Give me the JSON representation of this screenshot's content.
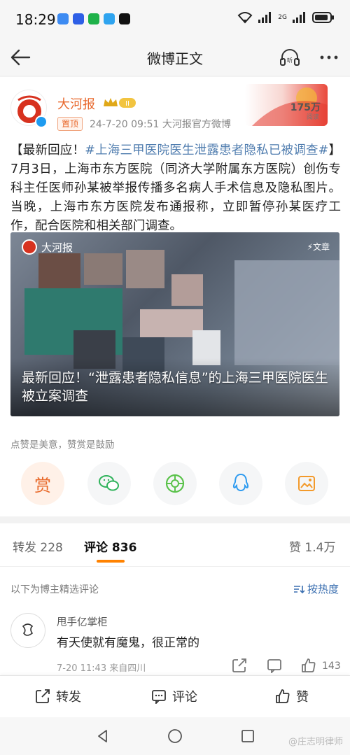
{
  "status_bar": {
    "time": "18:29",
    "network": "2G",
    "battery_icon": "battery-icon"
  },
  "nav": {
    "title": "微博正文",
    "listen_label": "听"
  },
  "post": {
    "author": "大河报",
    "rank_badge": "II",
    "pin_label": "置顶",
    "meta": "24-7-20 09:51   大河报官方微博",
    "banner_count": "175万",
    "banner_sub": "阅读",
    "text_prefix": "【最新回应！",
    "hashtag": "#上海三甲医院医生泄露患者隐私已被调查#",
    "text_body": "】 7月3日，上海市东方医院（同济大学附属东方医院）创伤专科主任医师孙某被举报传播多名病人手术信息及隐私图片。当晚，上海市东方医院发布通报称，立即暂停孙某医疗工作，配合医院和相关部门调查。",
    "media": {
      "logo_text": "大河报",
      "tag": "⚡文章",
      "caption": "最新回应！“泄露患者隐私信息”的上海三甲医院医生被立案调查"
    },
    "reward_hint": "点赞是美意，赞赏是鼓励",
    "reward_label": "赏"
  },
  "tabs": {
    "repost": "转发 228",
    "comments": "评论 836",
    "likes": "赞 1.4万"
  },
  "comments": {
    "hint": "以下为博主精选评论",
    "sort_label": "按热度",
    "items": [
      {
        "user": "甩手亿掌柜",
        "text": "有天使就有魔鬼，很正常的",
        "meta": "7-20 11:43  来自四川",
        "likes": "143"
      }
    ]
  },
  "actions": {
    "repost": "转发",
    "comment": "评论",
    "like": "赞"
  },
  "watermark": "@庄志明律师",
  "colors": {
    "accent": "#ff8200",
    "author": "#e8672b",
    "link": "#507daf",
    "sort": "#3b6fb0"
  }
}
